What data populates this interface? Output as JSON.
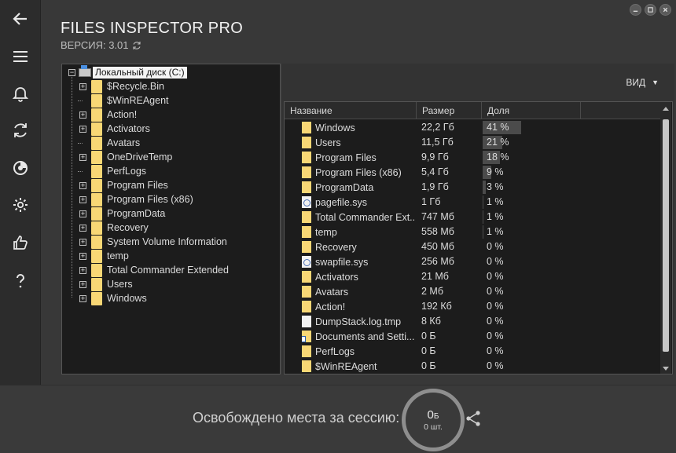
{
  "app": {
    "title": "FILES INSPECTOR PRO",
    "version": "ВЕРСИЯ: 3.01"
  },
  "sidebar": {
    "items": [
      {
        "name": "back-icon"
      },
      {
        "name": "menu-icon"
      },
      {
        "name": "bell-icon"
      },
      {
        "name": "refresh-icon"
      },
      {
        "name": "disk-icon"
      },
      {
        "name": "gear-icon"
      },
      {
        "name": "thumbs-up-icon"
      },
      {
        "name": "help-icon"
      }
    ]
  },
  "tree": {
    "root": "Локальный диск (C:)",
    "items": [
      {
        "label": "$Recycle.Bin",
        "expandable": true
      },
      {
        "label": "$WinREAgent",
        "expandable": false
      },
      {
        "label": "Action!",
        "expandable": true
      },
      {
        "label": "Activators",
        "expandable": true
      },
      {
        "label": "Avatars",
        "expandable": false
      },
      {
        "label": "OneDriveTemp",
        "expandable": true
      },
      {
        "label": "PerfLogs",
        "expandable": false
      },
      {
        "label": "Program Files",
        "expandable": true
      },
      {
        "label": "Program Files (x86)",
        "expandable": true
      },
      {
        "label": "ProgramData",
        "expandable": true
      },
      {
        "label": "Recovery",
        "expandable": true
      },
      {
        "label": "System Volume Information",
        "expandable": true
      },
      {
        "label": "temp",
        "expandable": true
      },
      {
        "label": "Total Commander Extended",
        "expandable": true
      },
      {
        "label": "Users",
        "expandable": true
      },
      {
        "label": "Windows",
        "expandable": true
      }
    ]
  },
  "view": {
    "label": "ВИД"
  },
  "table": {
    "columns": [
      "Название",
      "Размер",
      "Доля"
    ],
    "rows": [
      {
        "name": "Windows",
        "size": "22,2 Гб",
        "share": "41 %",
        "pct": 41,
        "type": "folder"
      },
      {
        "name": "Users",
        "size": "11,5 Гб",
        "share": "21 %",
        "pct": 21,
        "type": "folder"
      },
      {
        "name": "Program Files",
        "size": "9,9 Гб",
        "share": "18 %",
        "pct": 18,
        "type": "folder"
      },
      {
        "name": "Program Files (x86)",
        "size": "5,4 Гб",
        "share": "9 %",
        "pct": 9,
        "type": "folder"
      },
      {
        "name": "ProgramData",
        "size": "1,9 Гб",
        "share": "3 %",
        "pct": 3,
        "type": "folder"
      },
      {
        "name": "pagefile.sys",
        "size": "1 Гб",
        "share": "1 %",
        "pct": 1,
        "type": "sys"
      },
      {
        "name": "Total Commander Ext...",
        "size": "747 Мб",
        "share": "1 %",
        "pct": 1,
        "type": "folder"
      },
      {
        "name": "temp",
        "size": "558 Мб",
        "share": "1 %",
        "pct": 1,
        "type": "folder"
      },
      {
        "name": "Recovery",
        "size": "450 Мб",
        "share": "0 %",
        "pct": 0,
        "type": "folder"
      },
      {
        "name": "swapfile.sys",
        "size": "256 Мб",
        "share": "0 %",
        "pct": 0,
        "type": "sys"
      },
      {
        "name": "Activators",
        "size": "21 Мб",
        "share": "0 %",
        "pct": 0,
        "type": "folder"
      },
      {
        "name": "Avatars",
        "size": "2 Мб",
        "share": "0 %",
        "pct": 0,
        "type": "folder"
      },
      {
        "name": "Action!",
        "size": "192 Кб",
        "share": "0 %",
        "pct": 0,
        "type": "folder"
      },
      {
        "name": "DumpStack.log.tmp",
        "size": "8 Кб",
        "share": "0 %",
        "pct": 0,
        "type": "file"
      },
      {
        "name": "Documents and Setti...",
        "size": "0 Б",
        "share": "0 %",
        "pct": 0,
        "type": "link"
      },
      {
        "name": "PerfLogs",
        "size": "0 Б",
        "share": "0 %",
        "pct": 0,
        "type": "folder"
      },
      {
        "name": "$WinREAgent",
        "size": "0 Б",
        "share": "0 %",
        "pct": 0,
        "type": "folder"
      }
    ]
  },
  "footer": {
    "freed_label": "Освобождено места за сессию:",
    "freed_value": "0",
    "freed_unit": "Б",
    "freed_count": "0 шт."
  }
}
